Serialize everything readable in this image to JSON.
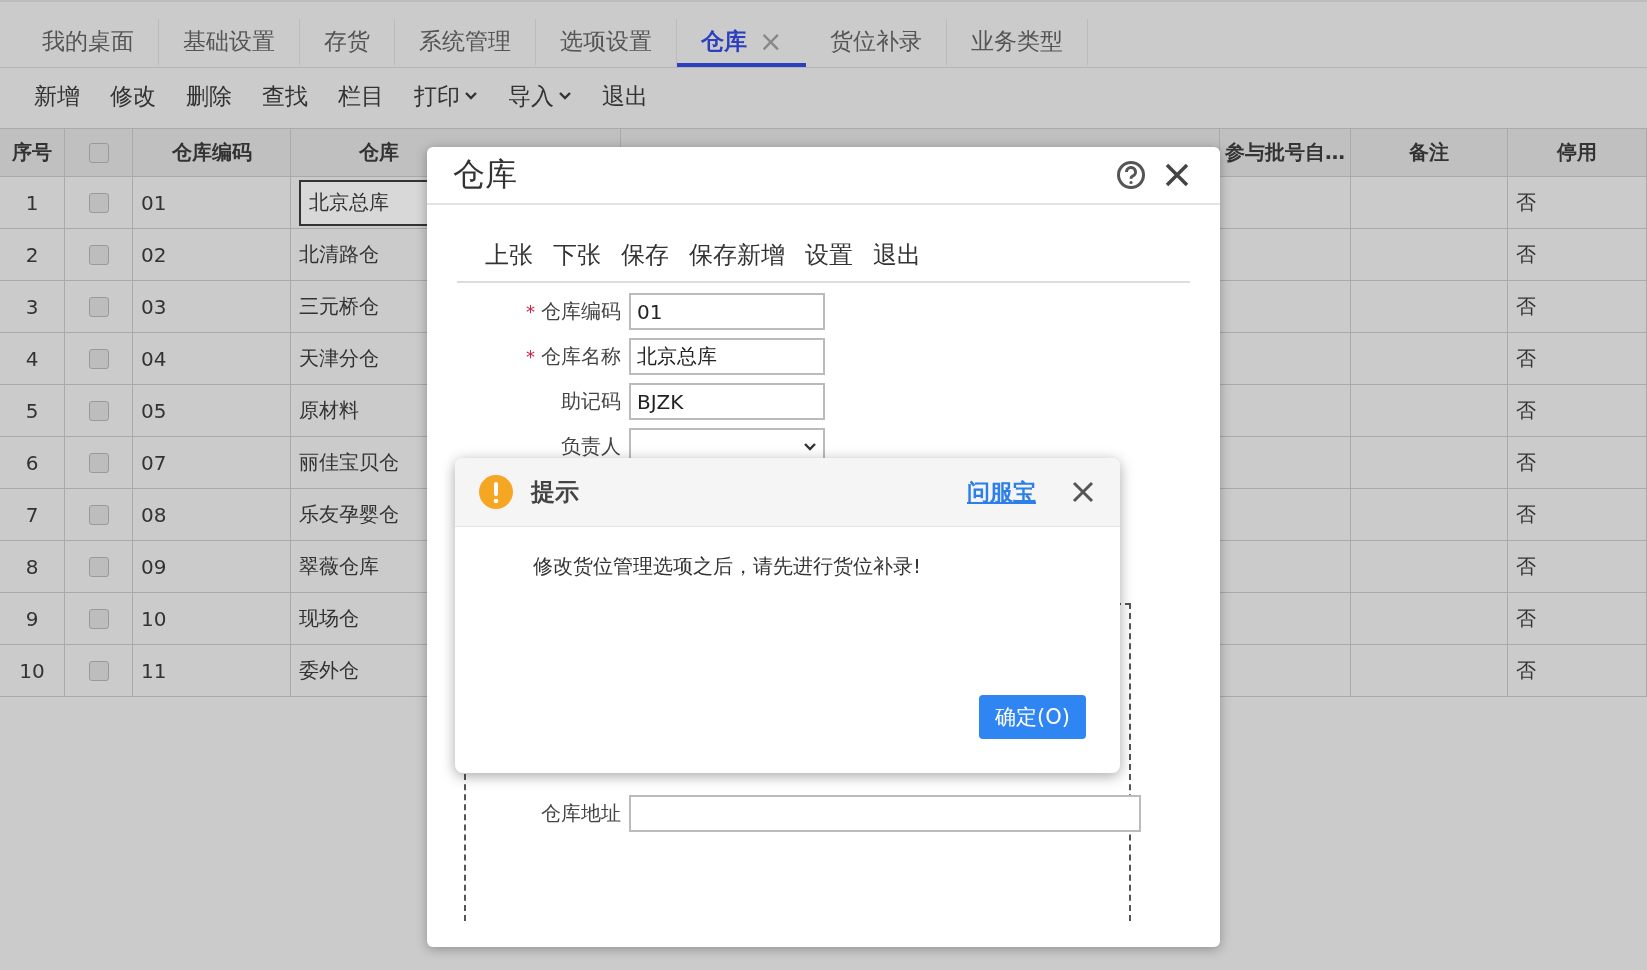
{
  "tabs": [
    {
      "label": "我的桌面",
      "selected": false
    },
    {
      "label": "基础设置",
      "selected": false
    },
    {
      "label": "存货",
      "selected": false
    },
    {
      "label": "系统管理",
      "selected": false
    },
    {
      "label": "选项设置",
      "selected": false
    },
    {
      "label": "仓库",
      "selected": true,
      "close": "×"
    },
    {
      "label": "货位补录",
      "selected": false
    },
    {
      "label": "业务类型",
      "selected": false
    }
  ],
  "toolbar": [
    {
      "label": "新增",
      "kind": "button"
    },
    {
      "label": "修改",
      "kind": "button"
    },
    {
      "label": "删除",
      "kind": "button"
    },
    {
      "label": "查找",
      "kind": "button"
    },
    {
      "label": "栏目",
      "kind": "button"
    },
    {
      "label": "打印",
      "kind": "dropdown"
    },
    {
      "label": "导入",
      "kind": "dropdown"
    },
    {
      "label": "退出",
      "kind": "button"
    }
  ],
  "table": {
    "columns": [
      {
        "label": "序号",
        "kind": "text"
      },
      {
        "kind": "checkbox",
        "checked": false
      },
      {
        "label": "仓库编码",
        "kind": "text"
      },
      {
        "label": "仓库",
        "kind": "text"
      },
      {
        "label": "参与批号自…",
        "kind": "text"
      },
      {
        "label": "备注",
        "kind": "text"
      },
      {
        "label": "停用",
        "kind": "text"
      }
    ],
    "rows": [
      {
        "no": "1",
        "checked": false,
        "code": "01",
        "name": "北京总库",
        "disabled": "否",
        "selected": true
      },
      {
        "no": "2",
        "checked": false,
        "code": "02",
        "name": "北清路仓",
        "disabled": "否",
        "selected": false
      },
      {
        "no": "3",
        "checked": false,
        "code": "03",
        "name": "三元桥仓",
        "disabled": "否",
        "selected": false
      },
      {
        "no": "4",
        "checked": false,
        "code": "04",
        "name": "天津分仓",
        "disabled": "否",
        "selected": false
      },
      {
        "no": "5",
        "checked": false,
        "code": "05",
        "name": "原材料",
        "disabled": "否",
        "selected": false
      },
      {
        "no": "6",
        "checked": false,
        "code": "07",
        "name": "丽佳宝贝仓",
        "disabled": "否",
        "selected": false
      },
      {
        "no": "7",
        "checked": false,
        "code": "08",
        "name": "乐友孕婴仓",
        "disabled": "否",
        "selected": false
      },
      {
        "no": "8",
        "checked": false,
        "code": "09",
        "name": "翠薇仓库",
        "disabled": "否",
        "selected": false
      },
      {
        "no": "9",
        "checked": false,
        "code": "10",
        "name": "现场仓",
        "disabled": "否",
        "selected": false
      },
      {
        "no": "10",
        "checked": false,
        "code": "11",
        "name": "委外仓",
        "disabled": "否",
        "selected": false
      }
    ]
  },
  "dialog": {
    "title": "仓库",
    "toolbar": [
      "上张",
      "下张",
      "保存",
      "保存新增",
      "设置",
      "退出"
    ],
    "fields": [
      {
        "label": "仓库编码",
        "required_mark": "*",
        "kind": "input",
        "value": "01"
      },
      {
        "label": "仓库名称",
        "required_mark": "*",
        "kind": "input",
        "value": "北京总库"
      },
      {
        "label": "助记码",
        "kind": "input",
        "value": "BJZK"
      },
      {
        "label": "负责人",
        "kind": "select"
      }
    ],
    "address_field": {
      "label": "仓库地址"
    }
  },
  "alert": {
    "title": "提示",
    "link": "问服宝",
    "message": "修改货位管理选项之后，请先进行货位补录!",
    "button": "确定(O)"
  }
}
